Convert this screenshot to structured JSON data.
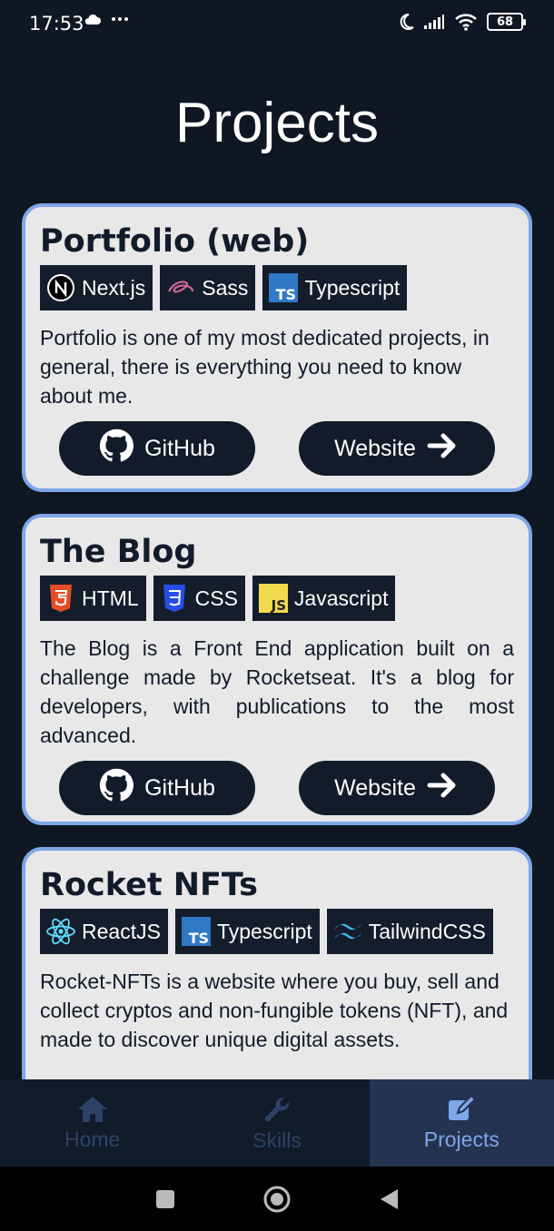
{
  "status_bar": {
    "time": "17:53",
    "battery": "68"
  },
  "page": {
    "title": "Projects"
  },
  "projects": [
    {
      "title": "Portfolio (web)",
      "tags": [
        {
          "label": "Next.js",
          "icon": "nextjs-icon"
        },
        {
          "label": "Sass",
          "icon": "sass-icon"
        },
        {
          "label": "Typescript",
          "icon": "typescript-icon"
        }
      ],
      "description": "Portfolio is one of my most dedicated projects, in general, there is everything you need to know about me.",
      "github_label": "GitHub",
      "website_label": "Website"
    },
    {
      "title": "The Blog",
      "tags": [
        {
          "label": "HTML",
          "icon": "html-icon"
        },
        {
          "label": "CSS",
          "icon": "css-icon"
        },
        {
          "label": "Javascript",
          "icon": "javascript-icon"
        }
      ],
      "description": "The Blog is a Front End application built on a challenge made by Rocketseat. It's a blog for developers, with publications to the most advanced.",
      "github_label": "GitHub",
      "website_label": "Website"
    },
    {
      "title": "Rocket NFTs",
      "tags": [
        {
          "label": "ReactJS",
          "icon": "react-icon"
        },
        {
          "label": "Typescript",
          "icon": "typescript-icon"
        },
        {
          "label": "TailwindCSS",
          "icon": "tailwind-icon"
        }
      ],
      "description": "Rocket-NFTs is a website where you buy, sell and collect cryptos and non-fungible tokens (NFT), and made to discover unique digital assets."
    }
  ],
  "bottom_nav": [
    {
      "label": "Home",
      "icon": "home-icon",
      "active": false
    },
    {
      "label": "Skills",
      "icon": "wrench-icon",
      "active": false
    },
    {
      "label": "Projects",
      "icon": "edit-icon",
      "active": true
    }
  ],
  "colors": {
    "background": "#0f1724",
    "card": "#e8e8e8",
    "card_border": "#7ea6e8",
    "dark": "#121b2a",
    "nav_active": "#24334f"
  }
}
